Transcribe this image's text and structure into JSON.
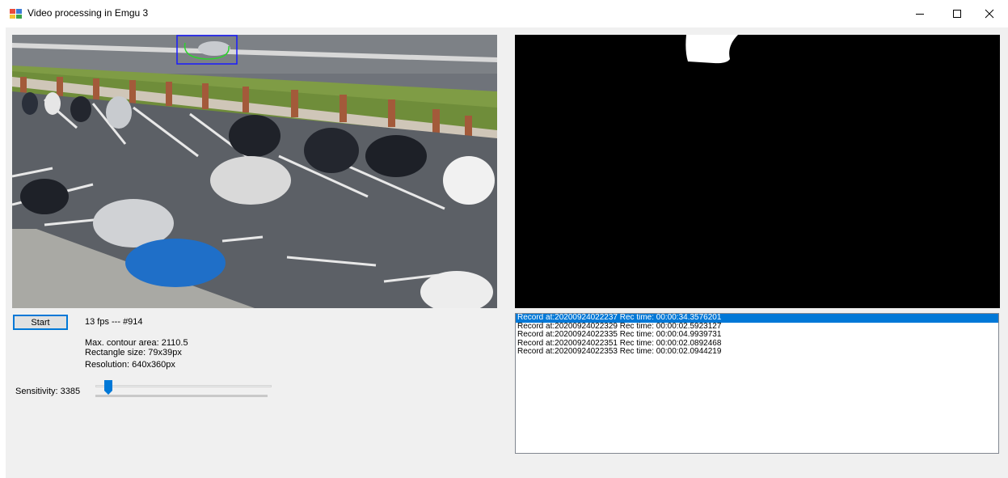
{
  "window": {
    "title": "Video processing in Emgu 3",
    "icon": "app-window-icon",
    "controls": [
      "minimize-icon",
      "maximize-icon",
      "close-icon"
    ]
  },
  "video": {
    "description_icon": "camera-feed-image",
    "mask_icon": "motion-mask-image"
  },
  "controls": {
    "start_label": "Start",
    "fps_text": "13 fps --- #914",
    "contour_text": "Max. contour area: 2110.5",
    "rect_text": "Rectangle size: 79x39px",
    "resolution_text": "Resolution: 640x360px",
    "sensitivity_text": "Sensitivity: 3385",
    "sensitivity_level": 0.03
  },
  "records": [
    {
      "text": "Record at:20200924022237 Rec time: 00:00:34.3576201",
      "selected": true
    },
    {
      "text": "Record at:20200924022329 Rec time: 00:00:02.5923127",
      "selected": false
    },
    {
      "text": "Record at:20200924022335 Rec time: 00:00:04.9939731",
      "selected": false
    },
    {
      "text": "Record at:20200924022351 Rec time: 00:00:02.0892468",
      "selected": false
    },
    {
      "text": "Record at:20200924022353 Rec time: 00:00:02.0944219",
      "selected": false
    }
  ],
  "colors": {
    "accent": "#0078d7",
    "client_bg": "#f0f0f0",
    "detect_box": "#1a1aff",
    "detect_contour": "#2bd52b"
  }
}
